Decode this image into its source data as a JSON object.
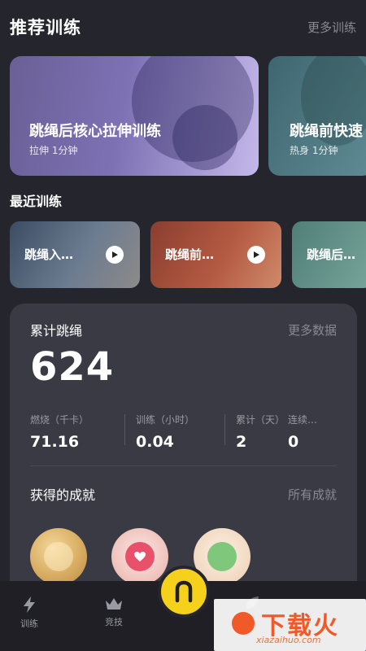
{
  "recommended": {
    "title": "推荐训练",
    "more": "更多训练",
    "cards": [
      {
        "title": "跳绳后核心拉伸训练",
        "subtitle": "拉伸 1分钟"
      },
      {
        "title": "跳绳前快速",
        "subtitle": "热身 1分钟"
      }
    ]
  },
  "recent": {
    "title": "最近训练",
    "items": [
      {
        "label": "跳绳入…"
      },
      {
        "label": "跳绳前…"
      },
      {
        "label": "跳绳后…"
      }
    ]
  },
  "stats": {
    "title": "累计跳绳",
    "more": "更多数据",
    "total": "624",
    "metrics": [
      {
        "label": "燃烧（千卡）",
        "value": "71.16"
      },
      {
        "label": "训练（小时）",
        "value": "0.04"
      },
      {
        "label": "累计（天）",
        "value": "2"
      },
      {
        "label": "连续…",
        "value": "0"
      }
    ]
  },
  "achievements": {
    "title": "获得的成就",
    "more": "所有成就"
  },
  "tabbar": {
    "items": [
      {
        "label": "训练",
        "icon": "lightning-icon"
      },
      {
        "label": "竞技",
        "icon": "crown-icon"
      }
    ],
    "center_icon": "rope-icon"
  },
  "watermark": {
    "text": "下载火",
    "url": "xiazaihuo.com"
  },
  "colors": {
    "background": "#25252d",
    "panel": "#3a3a44",
    "accent": "#f6d11c",
    "muted": "#8a8a93"
  }
}
